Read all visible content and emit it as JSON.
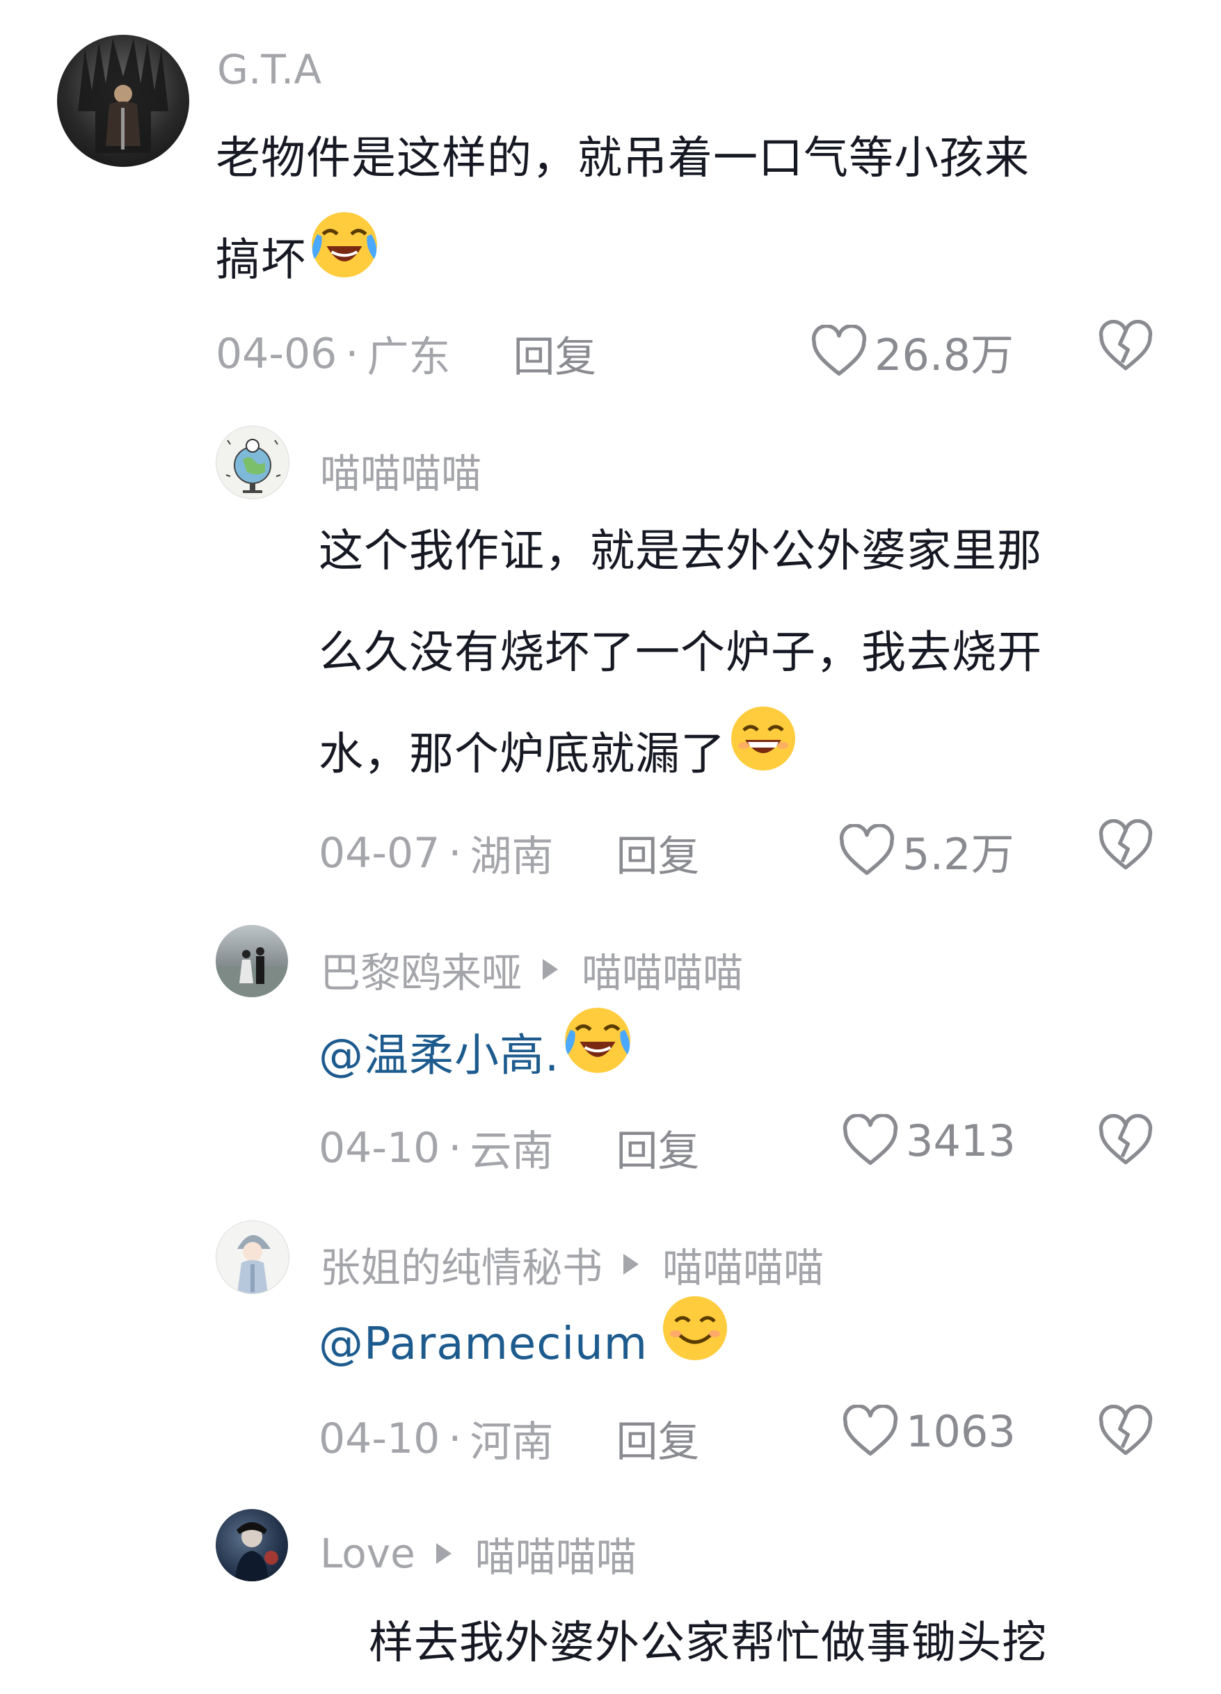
{
  "comments": [
    {
      "user": "G.T.A",
      "text": "老物件是这样的，就吊着一口气等小孩来搞坏",
      "text_line1": "老物件是这样的，就吊着一口气等小孩来",
      "text_line2": "搞坏",
      "emoji": "laughing-crying",
      "date": "04-06",
      "location": "广东",
      "reply_label": "回复",
      "likes": "26.8万"
    },
    {
      "user": "喵喵喵喵",
      "text_line1": "这个我作证，就是去外公外婆家里那",
      "text_line2": "么久没有烧坏了一个炉子，我去烧开",
      "text_line3": "水，那个炉底就漏了",
      "emoji": "grinning",
      "date": "04-07",
      "location": "湖南",
      "reply_label": "回复",
      "likes": "5.2万"
    },
    {
      "user": "巴黎鸥来哑",
      "reply_to": "喵喵喵喵",
      "text": "@温柔小高.",
      "emoji": "laughing-crying",
      "date": "04-10",
      "location": "云南",
      "reply_label": "回复",
      "likes": "3413"
    },
    {
      "user": "张姐的纯情秘书",
      "reply_to": "喵喵喵喵",
      "text": "@Paramecium",
      "emoji": "smiling",
      "date": "04-10",
      "location": "河南",
      "reply_label": "回复",
      "likes": "1063"
    },
    {
      "user": "Love",
      "reply_to": "喵喵喵喵",
      "text_partial": "样去我外婆外公家帮忙做事锄头挖"
    }
  ],
  "icons": {
    "like": "heart-outline-icon",
    "dislike": "broken-heart-icon",
    "reply_arrow": "triangle-right-icon"
  },
  "colors": {
    "meta_gray": "#a4a5aa",
    "mention_blue": "#1d5b8e",
    "text": "#161823"
  }
}
